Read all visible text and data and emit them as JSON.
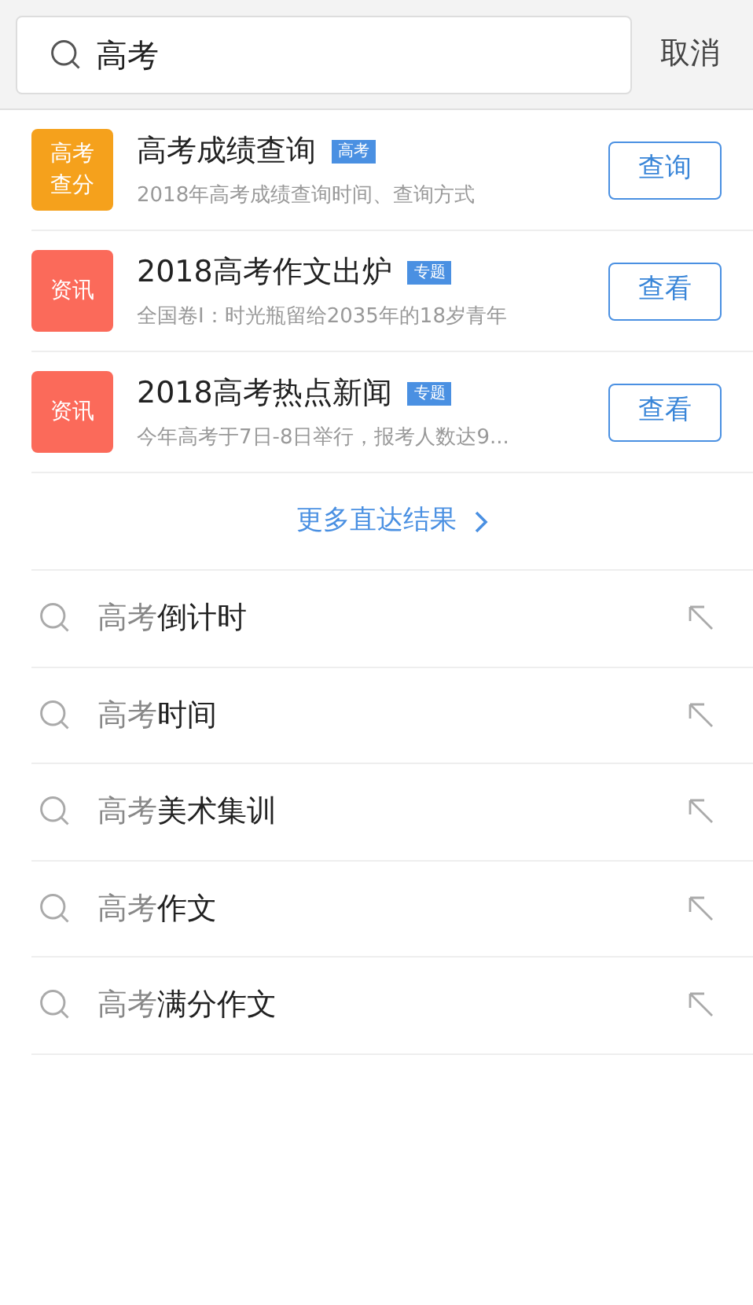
{
  "search": {
    "value": "高考",
    "cancel": "取消"
  },
  "results": [
    {
      "badge": "高考查分",
      "color": "#f5a11c",
      "title": "高考成绩查询",
      "tag": "高考",
      "subtitle": "2018年高考成绩查询时间、查询方式",
      "action": "查询"
    },
    {
      "badge": "资讯",
      "color": "#fb6a5a",
      "title": "2018高考作文出炉",
      "tag": "专题",
      "subtitle": "全国卷I：时光瓶留给2035年的18岁青年",
      "action": "查看"
    },
    {
      "badge": "资讯",
      "color": "#fb6a5a",
      "title": "2018高考热点新闻",
      "tag": "专题",
      "subtitle": "今年高考于7日-8日举行，报考人数达9...",
      "action": "查看"
    }
  ],
  "more": "更多直达结果",
  "suggestions": [
    {
      "match": "高考",
      "rest": "倒计时"
    },
    {
      "match": "高考",
      "rest": "时间"
    },
    {
      "match": "高考",
      "rest": "美术集训"
    },
    {
      "match": "高考",
      "rest": "作文"
    },
    {
      "match": "高考",
      "rest": "满分作文"
    }
  ]
}
